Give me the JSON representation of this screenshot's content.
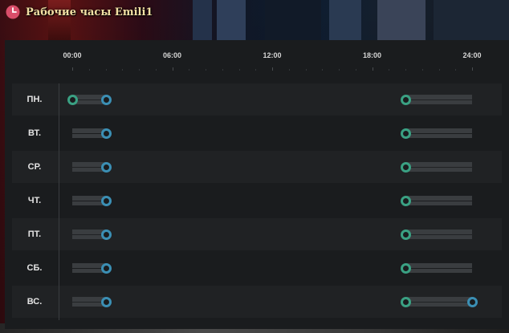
{
  "window": {
    "title": "Рабочие часы Emili1",
    "icon": "clock-icon"
  },
  "colors": {
    "start_handle": "#3aa183",
    "end_handle": "#3b8fb4",
    "track": "#3a3d40",
    "title": "#f3e0a4",
    "clock_icon": "#d94e6a"
  },
  "timeline": {
    "ticks": [
      "00:00",
      "06:00",
      "12:00",
      "18:00",
      "24:00"
    ],
    "range_hours": [
      0,
      24
    ]
  },
  "schedule": [
    {
      "day": "ПН.",
      "shifts": [
        {
          "start": 0,
          "end": 2,
          "show_start": true,
          "show_end": true
        },
        {
          "start": 20,
          "end": 24,
          "show_start": true,
          "show_end": false
        }
      ]
    },
    {
      "day": "ВТ.",
      "shifts": [
        {
          "start": 0,
          "end": 2,
          "show_start": false,
          "show_end": true
        },
        {
          "start": 20,
          "end": 24,
          "show_start": true,
          "show_end": false
        }
      ]
    },
    {
      "day": "СР.",
      "shifts": [
        {
          "start": 0,
          "end": 2,
          "show_start": false,
          "show_end": true
        },
        {
          "start": 20,
          "end": 24,
          "show_start": true,
          "show_end": false
        }
      ]
    },
    {
      "day": "ЧТ.",
      "shifts": [
        {
          "start": 0,
          "end": 2,
          "show_start": false,
          "show_end": true
        },
        {
          "start": 20,
          "end": 24,
          "show_start": true,
          "show_end": false
        }
      ]
    },
    {
      "day": "ПТ.",
      "shifts": [
        {
          "start": 0,
          "end": 2,
          "show_start": false,
          "show_end": true
        },
        {
          "start": 20,
          "end": 24,
          "show_start": true,
          "show_end": false
        }
      ]
    },
    {
      "day": "СБ.",
      "shifts": [
        {
          "start": 0,
          "end": 2,
          "show_start": false,
          "show_end": true
        },
        {
          "start": 20,
          "end": 24,
          "show_start": true,
          "show_end": false
        }
      ]
    },
    {
      "day": "ВС.",
      "shifts": [
        {
          "start": 0,
          "end": 2,
          "show_start": false,
          "show_end": true
        },
        {
          "start": 20,
          "end": 24,
          "show_start": true,
          "show_end": true
        }
      ]
    }
  ]
}
